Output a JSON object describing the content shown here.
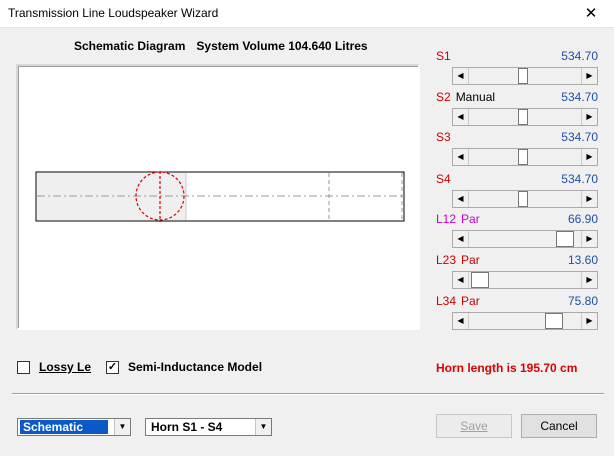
{
  "window": {
    "title": "Transmission Line Loudspeaker Wizard",
    "close_glyph": "✕"
  },
  "diagram": {
    "heading": "Schematic Diagram",
    "volume": "System Volume 104.640 Litres"
  },
  "params": [
    {
      "label": "S1",
      "sub": "",
      "value": "534.70",
      "thumb_pos": 0.52
    },
    {
      "label": "S2",
      "sub": "Manual",
      "value": "534.70",
      "thumb_pos": 0.52
    },
    {
      "label": "S3",
      "sub": "",
      "value": "534.70",
      "thumb_pos": 0.52
    },
    {
      "label": "S4",
      "sub": "",
      "value": "534.70",
      "thumb_pos": 0.52
    },
    {
      "label": "L12",
      "sub": "Par",
      "value": "66.90",
      "thumb_pos": 0.82
    },
    {
      "label": "L23",
      "sub": "Par",
      "value": "13.60",
      "thumb_pos": 0.1
    },
    {
      "label": "L34",
      "sub": "Par",
      "value": "75.80",
      "thumb_pos": 0.78
    }
  ],
  "options": {
    "lossy_label": "Lossy Le",
    "lossy_checked": false,
    "semi_label": "Semi-Inductance Model",
    "semi_checked": true,
    "check_glyph": "✓"
  },
  "horn_length": "Horn length is 195.70 cm",
  "footer": {
    "view_select": "Schematic",
    "horn_select": "Horn S1 - S4",
    "save": "Save",
    "cancel": "Cancel"
  },
  "icons": {
    "arrow_left": "◀",
    "arrow_right": "▶",
    "dropdown": "▼"
  },
  "colors": {
    "label_red": "#cc0000",
    "label_magenta": "#cc00cc",
    "value_blue": "#1f4fa8",
    "horn_red": "#dd0000",
    "selection_blue": "#0b58c8"
  }
}
